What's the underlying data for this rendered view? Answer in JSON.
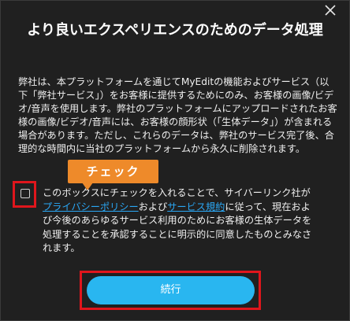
{
  "dialog": {
    "title": "より良いエクスペリエンスのためのデータ処理",
    "body": "弊社は、本プラットフォームを通じてMyEditの機能およびサービス（以下「弊社サービス」）をお客様に提供するためにのみ、お客様の画像/ビデオ/音声を使用します。弊社のプラットフォームにアップロードされたお客様の画像/ビデオ/音声には、お客様の顔形状（「生体データ」）が含まれる場合があります。ただし、これらのデータは、弊社のサービス完了後、合理的な時間内に当社のプラットフォームから永久に削除されます。",
    "callout": "チェック",
    "consent": {
      "part1": "このボックスにチェックを入れることで、サイバーリンク社が",
      "privacy_link": "プライバシーポリシー",
      "part2": "および",
      "terms_link": "サービス規約",
      "part3": "に従って、現在および今後のあらゆるサービス利用のためにお客様の生体データを処理することを承認することに明示的に同意したものとみなされます。"
    },
    "continue_label": "続行"
  },
  "colors": {
    "background": "#202020",
    "accent": "#29b6f0",
    "link": "#2aa7f5",
    "callout": "#ee8a2a",
    "highlight": "#e0161c"
  },
  "icons": {
    "close": "close-icon"
  }
}
